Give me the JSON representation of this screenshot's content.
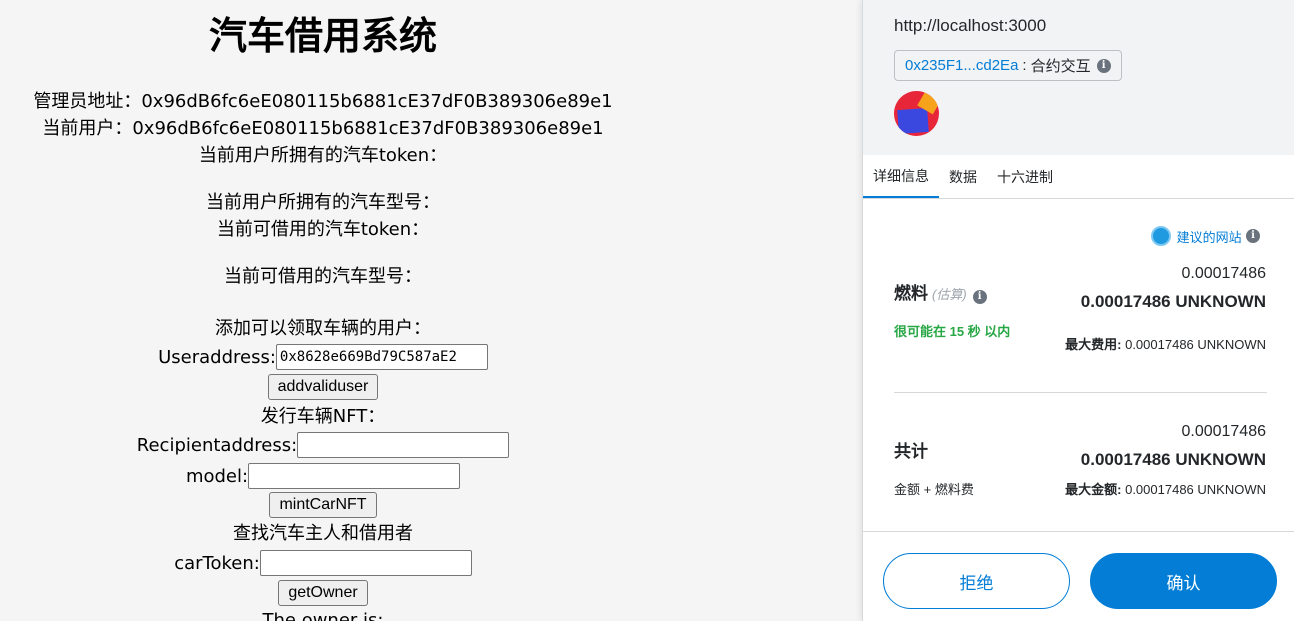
{
  "app": {
    "title": "汽车借用系统",
    "admin_line": "管理员地址：0x96dB6fc6eE080115b6881cE37dF0B389306e89e1",
    "user_line": "当前用户：0x96dB6fc6eE080115b6881cE37dF0B389306e89e1",
    "owned_tokens": "当前用户所拥有的汽车token：",
    "owned_models": "当前用户所拥有的汽车型号：",
    "available_tokens": "当前可借用的汽车token：",
    "available_models": "当前可借用的汽车型号：",
    "add_user_heading": "添加可以领取车辆的用户：",
    "useraddress_label": "Useraddress:",
    "useraddress_value": "0x8628e669Bd79C587aE2",
    "addvaliduser_button": "addvaliduser",
    "mint_heading": "发行车辆NFT：",
    "recipient_label": "Recipientaddress:",
    "recipient_value": "",
    "model_label": "model:",
    "model_value": "",
    "mint_button": "mintCarNFT",
    "find_heading": "查找汽车主人和借用者",
    "cartoken_label": "carToken:",
    "cartoken_value": "",
    "getowner_button": "getOwner",
    "owner_result": "The owner is:"
  },
  "wallet": {
    "origin": "http://localhost:3000",
    "contract_address": "0x235F1...cd2Ea",
    "contract_separator": ":",
    "contract_label": "合约交互",
    "tabs": [
      "详细信息",
      "数据",
      "十六进制"
    ],
    "active_tab": 0,
    "suggested_site": "建议的网站",
    "gas_label": "燃料",
    "gas_estimate_tag": "(估算)",
    "gas_value": "0.00017486",
    "gas_value_unit": "0.00017486 UNKNOWN",
    "gas_time": "很可能在 15 秒 以内",
    "max_fee_label": "最大费用:",
    "max_fee_value": "0.00017486 UNKNOWN",
    "total_label": "共计",
    "total_value": "0.00017486",
    "total_value_unit": "0.00017486 UNKNOWN",
    "total_sub": "金额 + 燃料费",
    "max_amount_label": "最大金额:",
    "max_amount_value": "0.00017486 UNKNOWN",
    "reject_button": "拒绝",
    "confirm_button": "确认",
    "colors": {
      "accent": "#037dd6",
      "green": "#28a745",
      "header_bg": "#f2f3f4"
    }
  }
}
